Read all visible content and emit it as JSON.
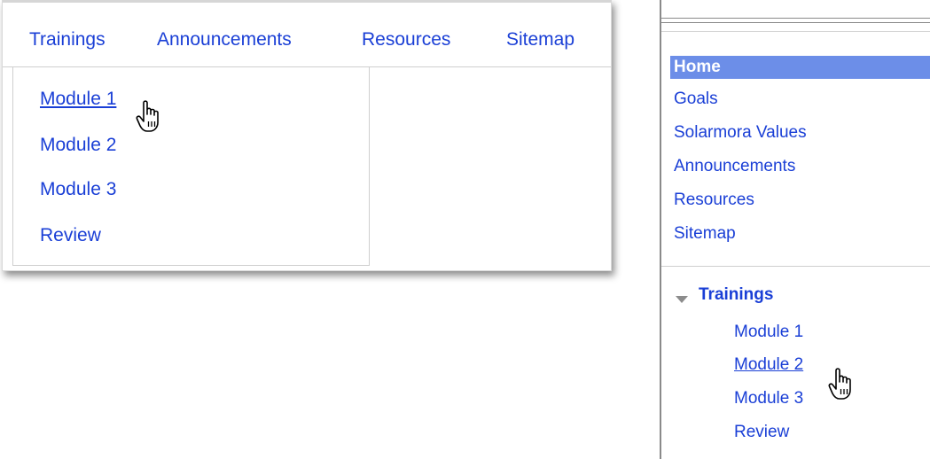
{
  "topnav": {
    "items": [
      {
        "label": "Trainings"
      },
      {
        "label": "Announcements"
      },
      {
        "label": "Resources"
      },
      {
        "label": "Sitemap"
      }
    ],
    "dropdown": {
      "items": [
        {
          "label": "Module 1",
          "hovered": true
        },
        {
          "label": "Module 2"
        },
        {
          "label": "Module 3"
        },
        {
          "label": "Review"
        }
      ]
    }
  },
  "sidebar": {
    "items": [
      {
        "label": "Home",
        "selected": true
      },
      {
        "label": "Goals"
      },
      {
        "label": "Solarmora Values"
      },
      {
        "label": "Announcements"
      },
      {
        "label": "Resources"
      },
      {
        "label": "Sitemap"
      }
    ],
    "tree": {
      "label": "Trainings",
      "expanded": true,
      "children": [
        {
          "label": "Module 1"
        },
        {
          "label": "Module 2",
          "hovered": true
        },
        {
          "label": "Module 3"
        },
        {
          "label": "Review"
        }
      ]
    }
  },
  "colors": {
    "link": "#1a3fd6",
    "selected_bg": "#6c8ee8",
    "selected_text": "#ffffff"
  },
  "icons": {
    "cursor": "hand-pointer-icon",
    "tree_toggle": "triangle-down-icon"
  }
}
